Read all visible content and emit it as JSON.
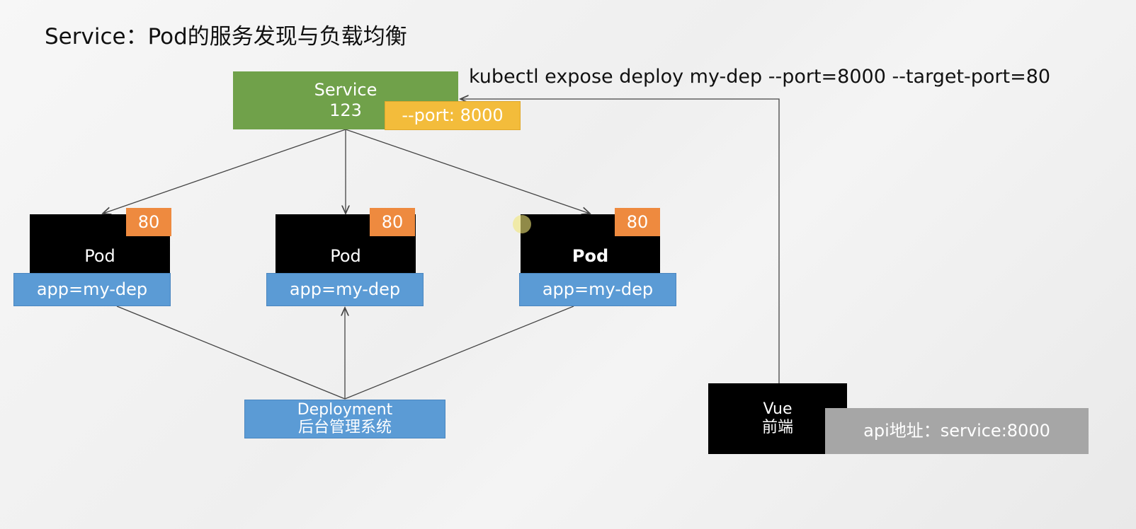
{
  "title": "Service：Pod的服务发现与负载均衡",
  "command": "kubectl expose deploy my-dep --port=8000 --target-port=80",
  "service": {
    "line1": "Service",
    "line2": "123",
    "port_label": "--port: 8000"
  },
  "pods": [
    {
      "name": "Pod",
      "port": "80",
      "label": "app=my-dep"
    },
    {
      "name": "Pod",
      "port": "80",
      "label": "app=my-dep"
    },
    {
      "name": "Pod",
      "port": "80",
      "label": "app=my-dep"
    }
  ],
  "deployment": {
    "line1": "Deployment",
    "line2": "后台管理系统"
  },
  "frontend": {
    "line1": "Vue",
    "line2": "前端",
    "api_label": "api地址：service:8000"
  },
  "colors": {
    "service": "#70a14a",
    "port": "#f3bc3b",
    "pod_port": "#ee8a3f",
    "label": "#5b9bd5",
    "pod": "#000000",
    "api": "#a6a6a6"
  }
}
